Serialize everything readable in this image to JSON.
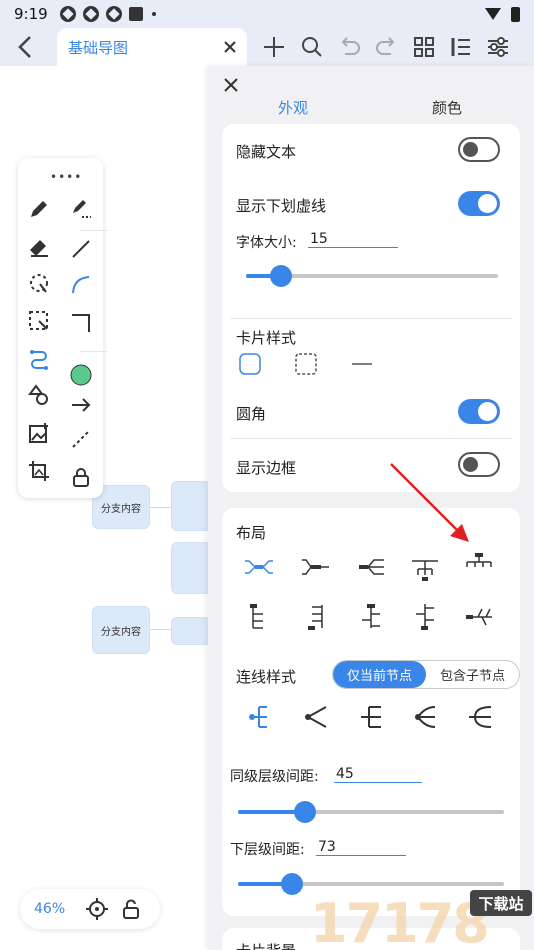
{
  "status_bar": {
    "time": "9:19"
  },
  "toolbar": {
    "tab_title": "基础导图",
    "icons": [
      "back-icon",
      "add-icon",
      "search-icon",
      "undo-icon",
      "redo-icon",
      "grid-icon",
      "outline-icon",
      "settings-sliders-icon"
    ]
  },
  "canvas": {
    "nodes": [
      "分支内容",
      "分支内容"
    ],
    "zoom": "46%"
  },
  "panel": {
    "tabs": [
      "外观",
      "颜色"
    ],
    "appearance": {
      "hide_text": {
        "label": "隐藏文本",
        "on": false
      },
      "show_underline": {
        "label": "显示下划虚线",
        "on": true
      },
      "font_size": {
        "label": "字体大小:",
        "value": "15",
        "slider_fraction": 0.13
      },
      "card_style": {
        "label": "卡片样式"
      },
      "rounded": {
        "label": "圆角",
        "on": true
      },
      "show_border": {
        "label": "显示边框",
        "on": false
      }
    },
    "layout": {
      "title": "布局",
      "line_style_label": "连线样式",
      "segment": [
        "仅当前节点",
        "包含子节点"
      ],
      "sibling_spacing": {
        "label": "同级层级间距:",
        "value": "45",
        "slider_fraction": 0.25
      },
      "child_spacing": {
        "label": "下层级间距:",
        "value": "73",
        "slider_fraction": 0.2
      },
      "card_bg_label": "卡片背景"
    }
  },
  "colors": {
    "accent": "#3a86e8",
    "node_fill": "#dce9f8",
    "annotation_arrow": "#e02020",
    "circle_tool": "#5cc88a"
  },
  "watermark": {
    "text": "17178",
    "badge": "下载站"
  }
}
